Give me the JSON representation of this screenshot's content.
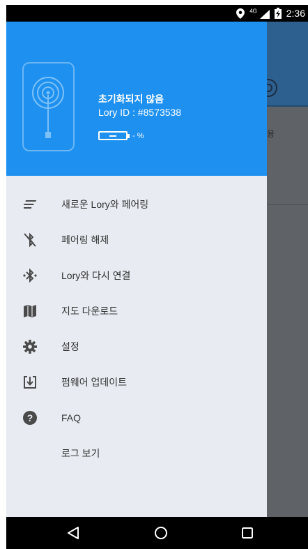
{
  "status_bar": {
    "network": "4G",
    "time": "2:36"
  },
  "background_app": {
    "partial_text": "용"
  },
  "drawer": {
    "header": {
      "device_status": "초기화되지 않음",
      "device_id": "Lory ID : #8573538",
      "battery_text": "- %"
    },
    "menu_items": [
      {
        "label": "새로운 Lory와 페어링",
        "icon": "menu-lines-icon"
      },
      {
        "label": "페어링 해제",
        "icon": "bluetooth-disabled-icon"
      },
      {
        "label": "Lory와 다시 연결",
        "icon": "bluetooth-connect-icon"
      },
      {
        "label": "지도 다운로드",
        "icon": "map-icon"
      },
      {
        "label": "설정",
        "icon": "gear-icon"
      },
      {
        "label": "펌웨어 업데이트",
        "icon": "download-icon"
      },
      {
        "label": "FAQ",
        "icon": "help-icon"
      },
      {
        "label": "로그 보기",
        "icon": ""
      }
    ]
  },
  "colors": {
    "header_blue": "#1e91f0",
    "drawer_bg": "#e8ecf2",
    "icon_gray": "#4a4a4a"
  }
}
